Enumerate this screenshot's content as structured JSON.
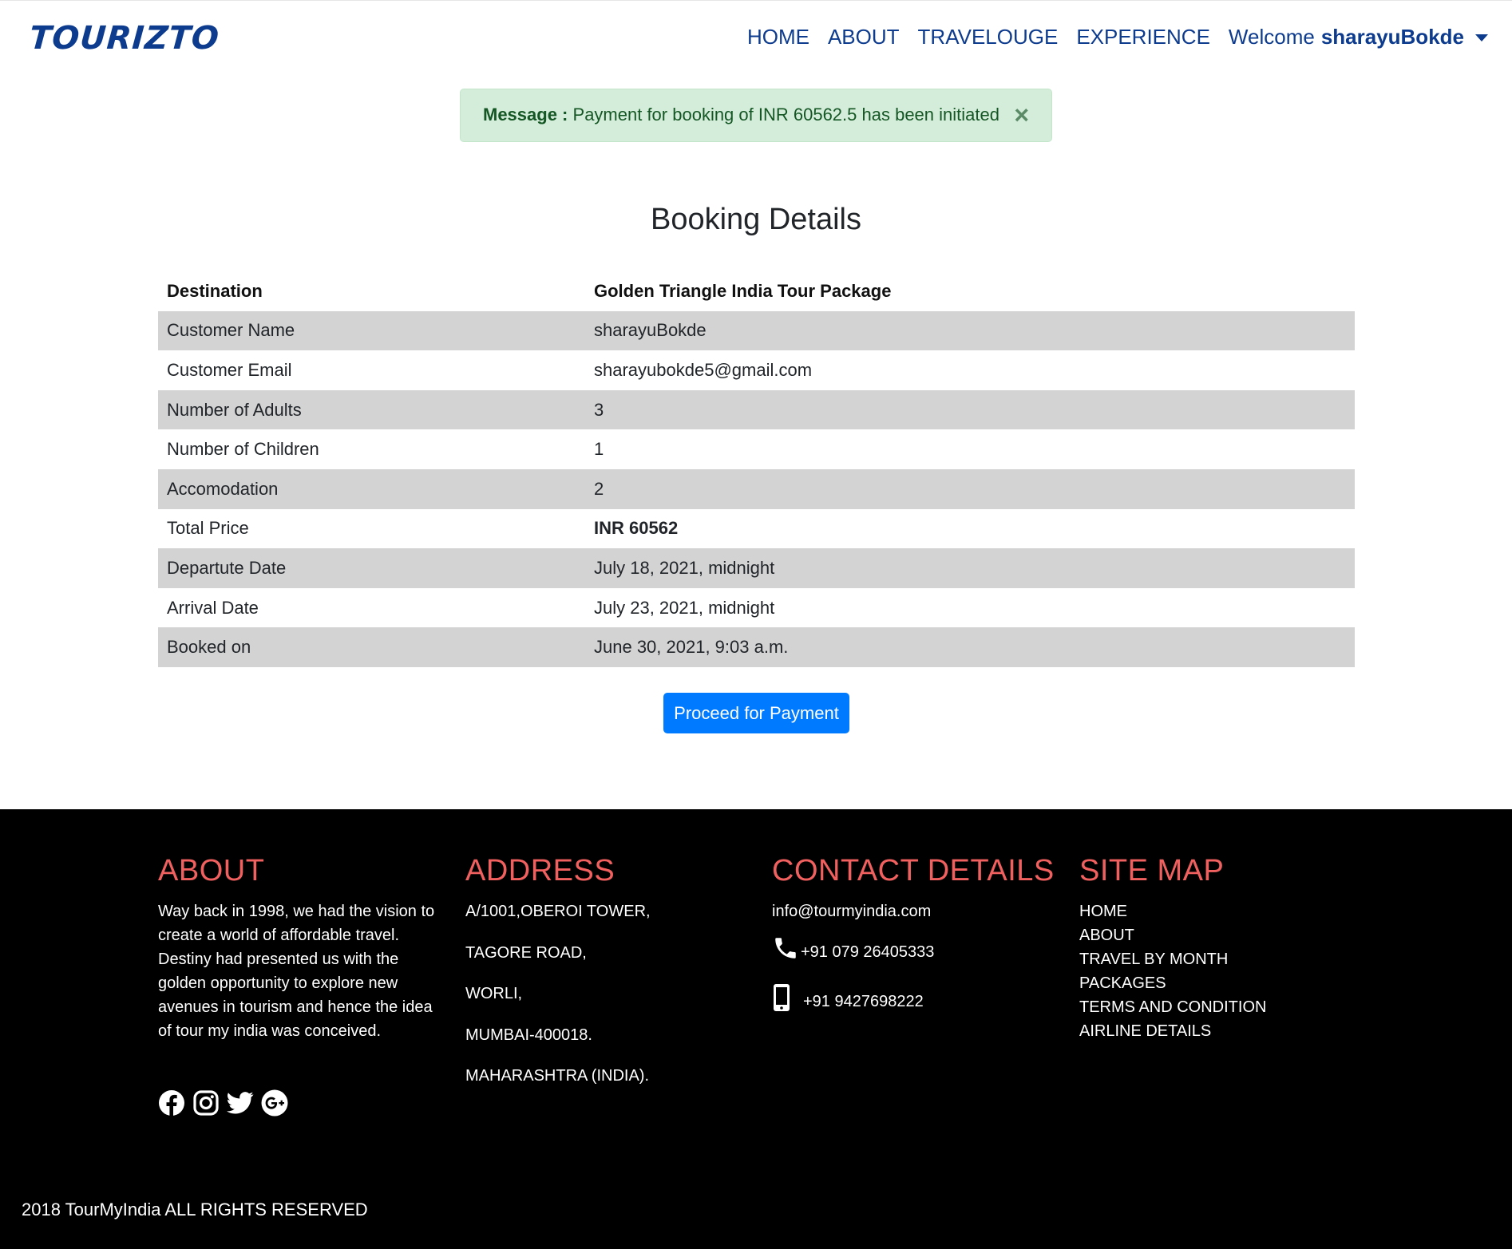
{
  "navbar": {
    "brand": "TOURIZTO",
    "links": [
      "HOME",
      "ABOUT",
      "TRAVELOUGE",
      "EXPERIENCE"
    ],
    "welcome": "Welcome",
    "username": "sharayuBokde"
  },
  "alert": {
    "label": "Message :",
    "text": "Payment for booking of INR 60562.5 has been initiated",
    "close": "×",
    "color": "#d4edda"
  },
  "page_title": "Booking Details",
  "details": {
    "header": {
      "key": "Destination",
      "value": "Golden Triangle India Tour Package"
    },
    "rows": [
      {
        "key": "Customer Name",
        "value": "sharayuBokde"
      },
      {
        "key": "Customer Email",
        "value": "sharayubokde5@gmail.com"
      },
      {
        "key": "Number of Adults",
        "value": "3"
      },
      {
        "key": "Number of Children",
        "value": "1"
      },
      {
        "key": "Accomodation",
        "value": "2"
      },
      {
        "key": "Total Price",
        "value": "INR 60562"
      },
      {
        "key": "Departute Date",
        "value": "July 18, 2021, midnight"
      },
      {
        "key": "Arrival Date",
        "value": "July 23, 2021, midnight"
      },
      {
        "key": "Booked on",
        "value": "June 30, 2021, 9:03 a.m."
      }
    ]
  },
  "pay_button": "Proceed for Payment",
  "footer": {
    "about": {
      "title": "ABOUT",
      "text": "Way back in 1998, we had the vision to create a world of affordable travel. Destiny had presented us with the golden opportunity to explore new avenues in tourism and hence the idea of tour my india was conceived."
    },
    "address": {
      "title": "ADDRESS",
      "lines": [
        "A/1001,OBEROI TOWER,",
        "TAGORE ROAD,",
        "WORLI,",
        "MUMBAI-400018.",
        "MAHARASHTRA (INDIA)."
      ]
    },
    "contact": {
      "title": "CONTACT DETAILS",
      "email": "info@tourmyindia.com",
      "phone": "+91 079 26405333",
      "mobile": "+91 9427698222"
    },
    "sitemap": {
      "title": "SITE MAP",
      "links": [
        "HOME",
        "ABOUT",
        "TRAVEL BY MONTH",
        "PACKAGES",
        "TERMS AND CONDITION",
        "AIRLINE DETAILS"
      ]
    },
    "socials": [
      "facebook-icon",
      "instagram-icon",
      "twitter-icon",
      "google-plus-icon"
    ],
    "copyright": "2018 TourMyIndia ALL RIGHTS RESERVED",
    "heading_color": "#f0605f"
  }
}
